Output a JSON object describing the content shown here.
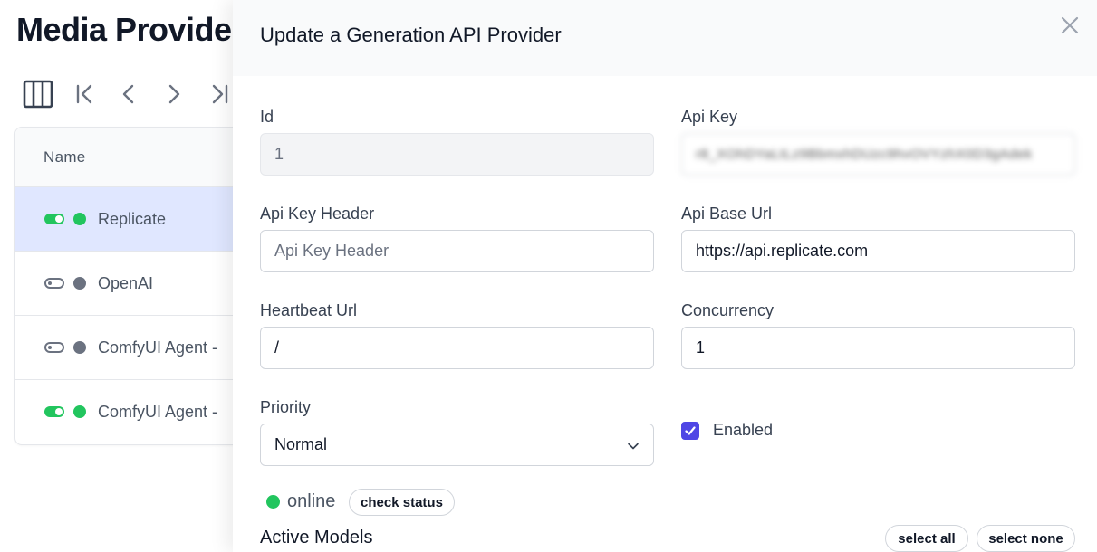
{
  "page": {
    "title": "Media Providers",
    "toolbar": {
      "columns_icon": "columns-icon",
      "first_icon": "chevron-first-icon",
      "prev_icon": "chevron-left-icon",
      "next_icon": "chevron-right-icon",
      "last_icon": "chevron-last-icon"
    },
    "table": {
      "header": "Name",
      "rows": [
        {
          "name": "Replicate",
          "enabled": true,
          "online": true,
          "selected": true
        },
        {
          "name": "OpenAI",
          "enabled": false,
          "online": false,
          "selected": false
        },
        {
          "name": "ComfyUI Agent - ",
          "enabled": false,
          "online": false,
          "selected": false
        },
        {
          "name": "ComfyUI Agent - ",
          "enabled": true,
          "online": true,
          "selected": false
        }
      ]
    }
  },
  "dialog": {
    "title": "Update a Generation API Provider",
    "close_icon": "close-icon",
    "fields": {
      "id": {
        "label": "Id",
        "value": "1"
      },
      "api_key": {
        "label": "Api Key",
        "value": "r8_XOhDYaLtLz9BbmxhDUzc9hvOVYzhX0D3gAdek"
      },
      "api_key_header": {
        "label": "Api Key Header",
        "value": "",
        "placeholder": "Api Key Header"
      },
      "api_base_url": {
        "label": "Api Base Url",
        "value": "https://api.replicate.com"
      },
      "heartbeat_url": {
        "label": "Heartbeat Url",
        "value": "/"
      },
      "concurrency": {
        "label": "Concurrency",
        "value": "1"
      },
      "priority": {
        "label": "Priority",
        "selected": "Normal"
      },
      "enabled": {
        "label": "Enabled",
        "checked": true
      }
    },
    "status": {
      "text": "online",
      "color": "#22c55e",
      "check_label": "check status"
    },
    "active_models": {
      "title": "Active Models",
      "select_all_label": "select all",
      "select_none_label": "select none"
    }
  },
  "colors": {
    "accent": "#4f46e5",
    "online": "#22c55e",
    "offline": "#6b7280",
    "selected_row": "#e0e7ff"
  }
}
